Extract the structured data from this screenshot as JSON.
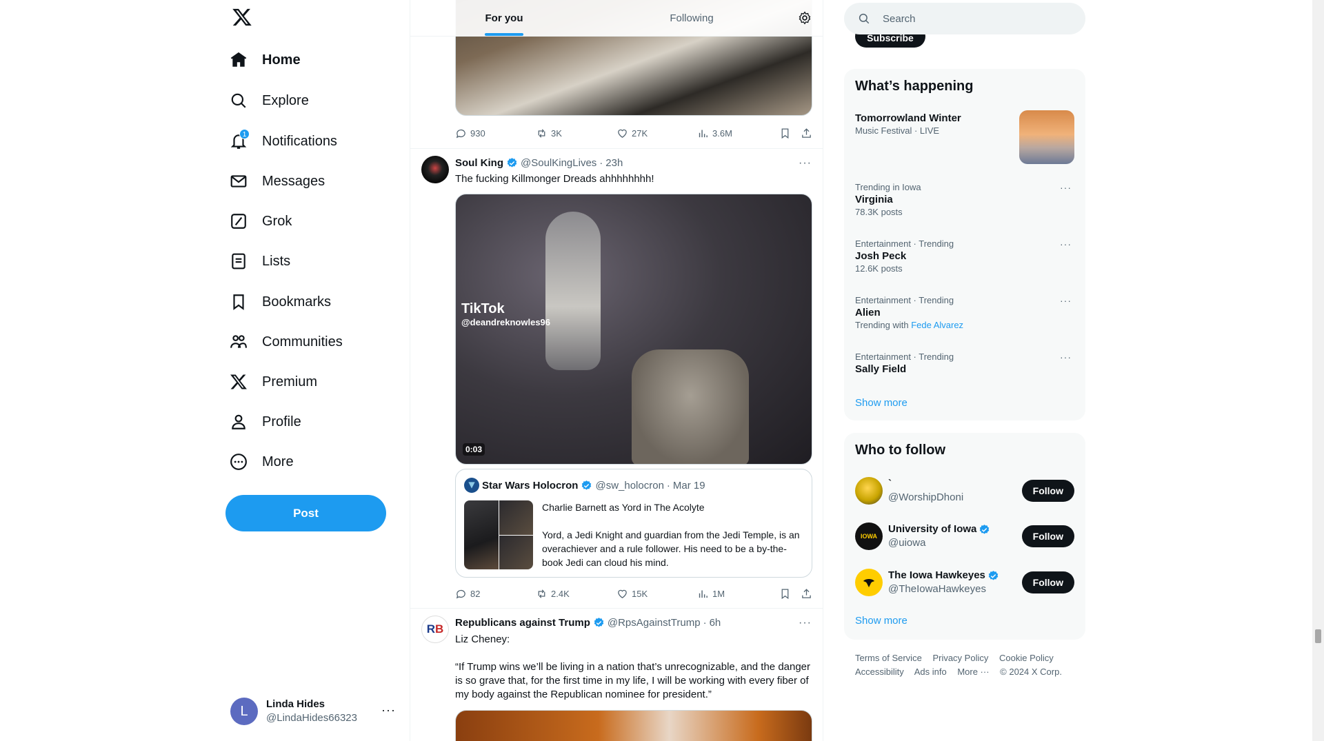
{
  "nav": {
    "logo": "X",
    "items": [
      {
        "label": "Home",
        "icon": "home-icon"
      },
      {
        "label": "Explore",
        "icon": "search-icon"
      },
      {
        "label": "Notifications",
        "icon": "bell-icon",
        "badge": "1"
      },
      {
        "label": "Messages",
        "icon": "envelope-icon"
      },
      {
        "label": "Grok",
        "icon": "grok-icon"
      },
      {
        "label": "Lists",
        "icon": "lists-icon"
      },
      {
        "label": "Bookmarks",
        "icon": "bookmark-icon"
      },
      {
        "label": "Communities",
        "icon": "communities-icon"
      },
      {
        "label": "Premium",
        "icon": "x-logo-icon"
      },
      {
        "label": "Profile",
        "icon": "person-icon"
      },
      {
        "label": "More",
        "icon": "more-circle-icon"
      }
    ],
    "post_label": "Post",
    "account": {
      "initial": "L",
      "name": "Linda Hides",
      "handle": "@LindaHides66323"
    }
  },
  "feed": {
    "tabs": [
      "For you",
      "Following"
    ],
    "top_tweet_stats": {
      "replies": "930",
      "reposts": "3K",
      "likes": "27K",
      "views": "3.6M"
    },
    "tweet1": {
      "name": "Soul King",
      "handle": "@SoulKingLives",
      "time": "23h",
      "text": "The fucking Killmonger Dreads ahhhhhhhh!",
      "video": {
        "brand": "TikTok",
        "watermark": "@deandreknowles96",
        "duration": "0:03"
      },
      "quote": {
        "name": "Star Wars Holocron",
        "handle": "@sw_holocron",
        "date": "Mar 19",
        "text": "Charlie Barnett as Yord in The Acolyte\n\nYord, a Jedi Knight and guardian from the Jedi Temple, is an overachiever and a rule follower. His need to be a by-the-book Jedi can cloud his mind."
      },
      "stats": {
        "replies": "82",
        "reposts": "2.4K",
        "likes": "15K",
        "views": "1M"
      }
    },
    "tweet2": {
      "name": "Republicans against Trump",
      "handle": "@RpsAgainstTrump",
      "time": "6h",
      "line1": "Liz Cheney:",
      "text": "“If Trump wins we’ll be living in a nation that’s unrecognizable, and the danger is so grave that, for the first time in my life, I will be working with every fiber of my body against the Republican nominee for president.”"
    }
  },
  "right": {
    "search_placeholder": "Search",
    "subscribe_peek": "Subscribe",
    "happening": {
      "title": "What’s happening",
      "featured": {
        "title": "Tomorrowland Winter",
        "meta": "Music Festival · LIVE"
      },
      "trends": [
        {
          "meta": "Trending in Iowa",
          "title": "Virginia",
          "sub": "78.3K posts"
        },
        {
          "meta": "Entertainment · Trending",
          "title": "Josh Peck",
          "sub": "12.6K posts"
        },
        {
          "meta": "Entertainment · Trending",
          "title": "Alien",
          "sub_prefix": "Trending with",
          "sub_link": "Fede Alvarez"
        },
        {
          "meta": "Entertainment · Trending",
          "title": "Sally Field"
        }
      ],
      "show_more": "Show more"
    },
    "who_to_follow": {
      "title": "Who to follow",
      "accounts": [
        {
          "name": "`",
          "handle": "@WorshipDhoni",
          "verified": false
        },
        {
          "name": "University of Iowa",
          "handle": "@uiowa",
          "verified": true,
          "avatar_text": "IOWA"
        },
        {
          "name": "The Iowa Hawkeyes",
          "handle": "@TheIowaHawkeyes",
          "verified": true
        }
      ],
      "follow_label": "Follow",
      "show_more": "Show more"
    },
    "footer": {
      "links": [
        "Terms of Service",
        "Privacy Policy",
        "Cookie Policy",
        "Accessibility",
        "Ads info",
        "More ···"
      ],
      "copyright": "© 2024 X Corp."
    }
  },
  "colors": {
    "accent": "#1d9bf0",
    "text": "#0f1419",
    "muted": "#536471"
  }
}
